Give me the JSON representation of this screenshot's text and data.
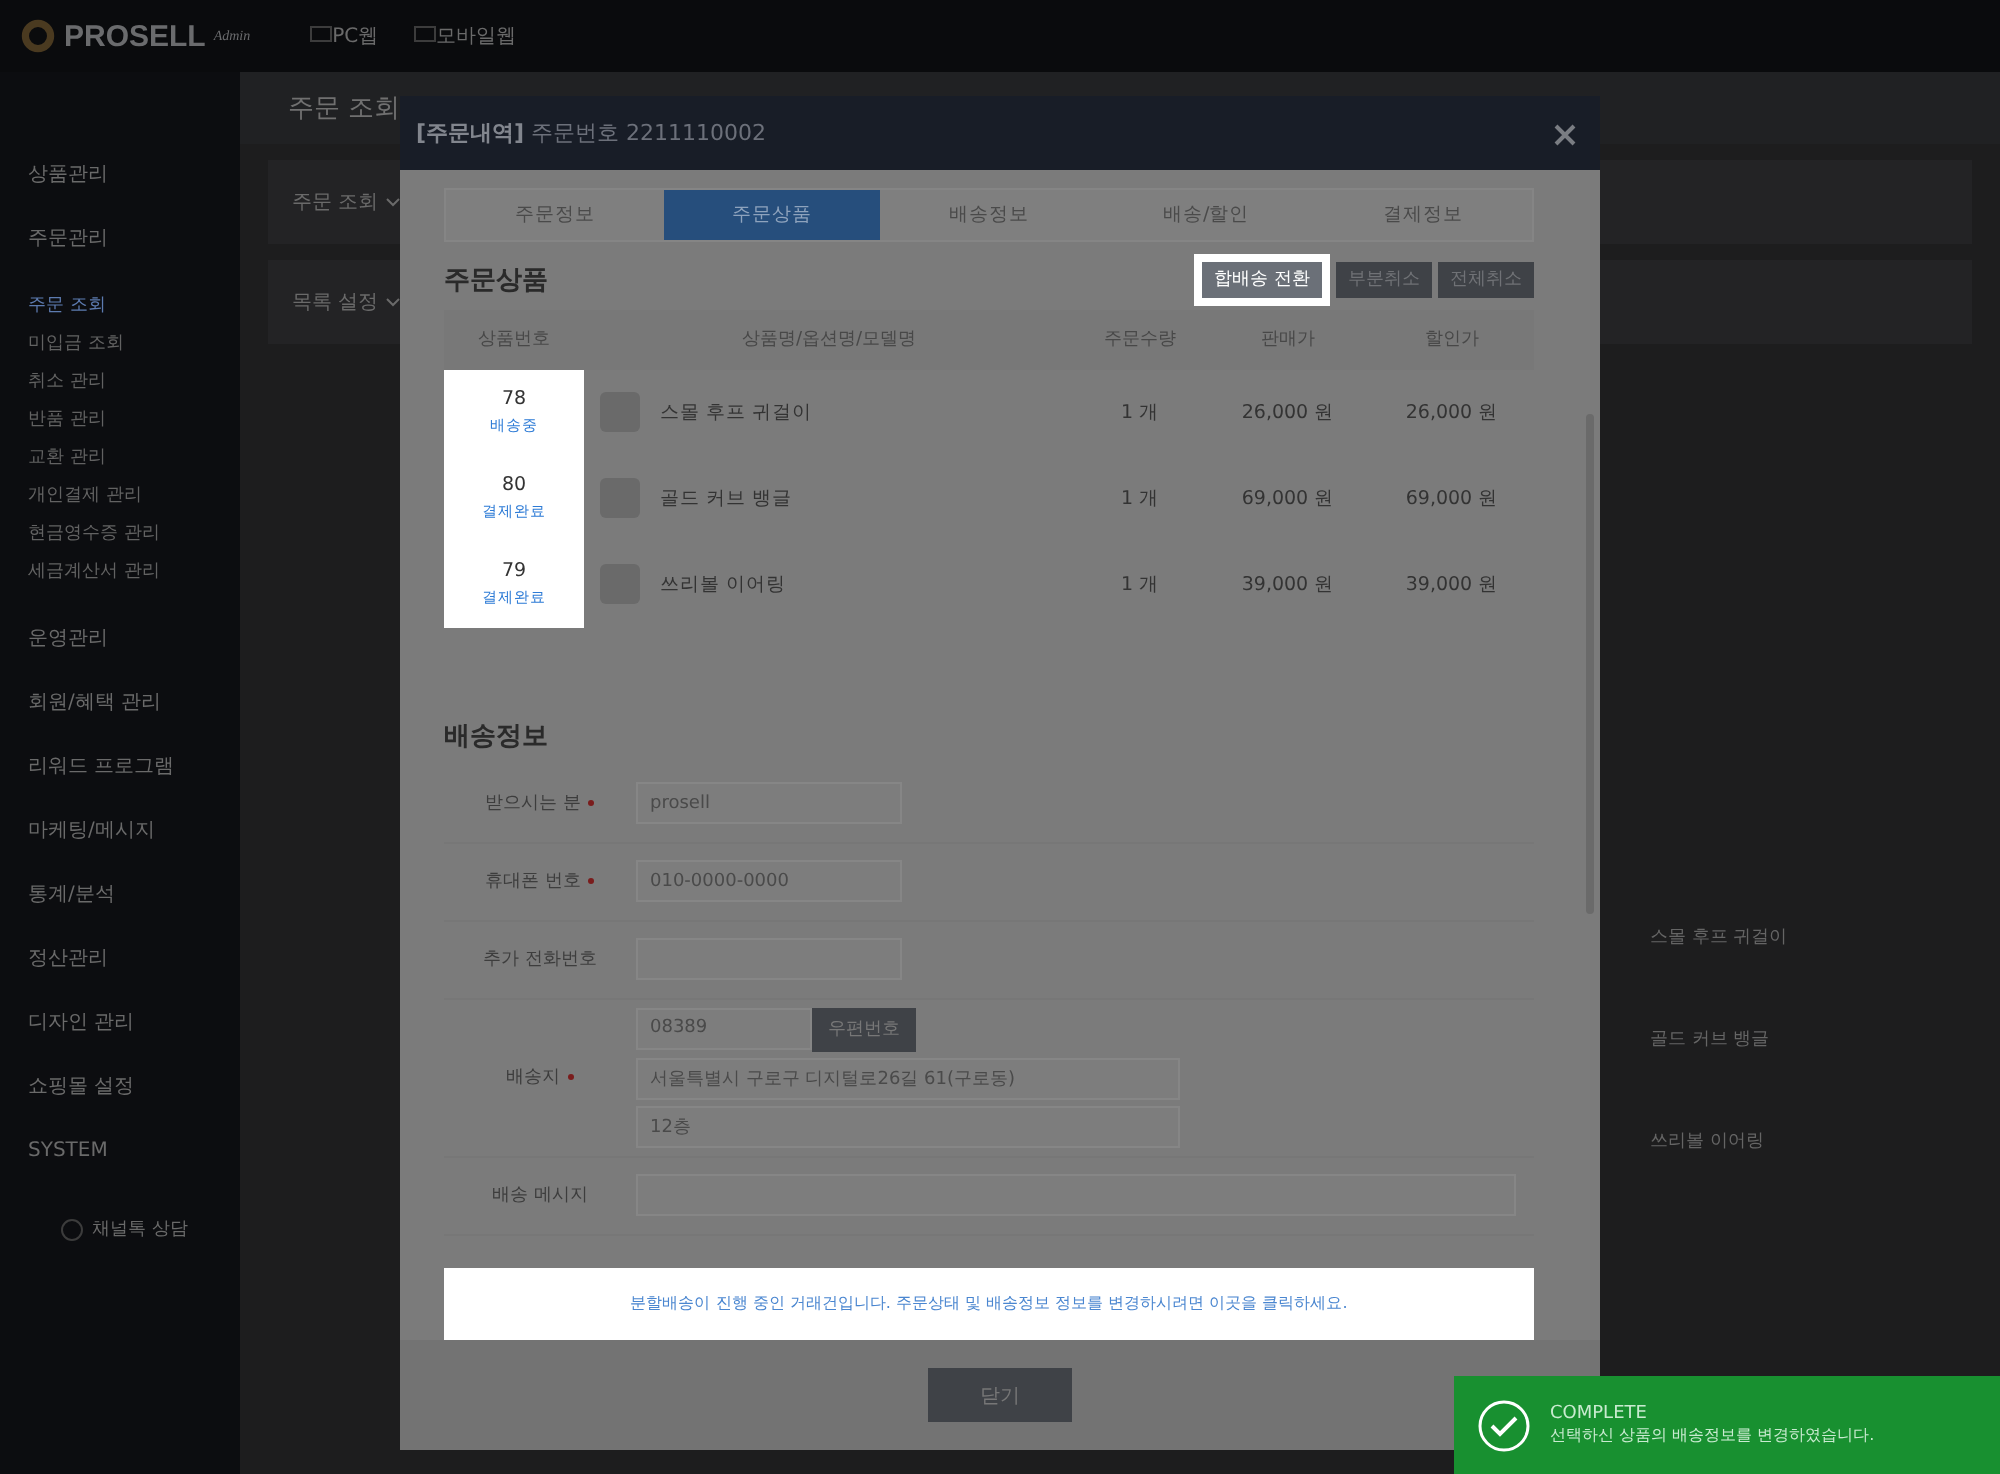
{
  "header": {
    "logo": "PROSELL",
    "logo_sub": "Admin",
    "links": [
      "PC웹",
      "모바일웹"
    ]
  },
  "sidebar": {
    "items": [
      {
        "label": "상품관리"
      },
      {
        "label": "주문관리",
        "children": [
          {
            "label": "주문 조회",
            "selected": true
          },
          {
            "label": "미입금 조회",
            "selected": false
          },
          {
            "label": "취소 관리",
            "selected": false
          },
          {
            "label": "반품 관리",
            "selected": false
          },
          {
            "label": "교환 관리",
            "selected": false
          },
          {
            "label": "개인결제 관리",
            "selected": false
          },
          {
            "label": "현금영수증 관리",
            "selected": false
          },
          {
            "label": "세금계산서 관리",
            "selected": false
          }
        ]
      },
      {
        "label": "운영관리"
      },
      {
        "label": "회원/혜택 관리"
      },
      {
        "label": "리워드 프로그램"
      },
      {
        "label": "마케팅/메시지"
      },
      {
        "label": "통계/분석"
      },
      {
        "label": "정산관리"
      },
      {
        "label": "디자인 관리"
      },
      {
        "label": "쇼핑몰 설정"
      },
      {
        "label": "SYSTEM"
      }
    ],
    "chat_button": "채널톡 상담"
  },
  "page": {
    "title": "주문 조회",
    "filters": [
      "주문 조회",
      "목록 설정"
    ],
    "product_list": [
      "스몰 후프 귀걸이",
      "골드 커브 뱅글",
      "쓰리볼 이어링"
    ]
  },
  "modal": {
    "title_bold": "[주문내역]",
    "title": "주문번호 2211110002",
    "tabs": [
      {
        "label": "주문정보",
        "selected": false
      },
      {
        "label": "주문상품",
        "selected": true
      },
      {
        "label": "배송정보",
        "selected": false
      },
      {
        "label": "배송/할인",
        "selected": false
      },
      {
        "label": "결제정보",
        "selected": false
      }
    ],
    "products": {
      "title": "주문상품",
      "buttons": [
        {
          "label": "합배송 전환",
          "highlighted": true
        },
        {
          "label": "부분취소",
          "highlighted": false
        },
        {
          "label": "전체취소",
          "highlighted": false
        }
      ],
      "columns": [
        "상품번호",
        "상품명/옵션명/모델명",
        "주문수량",
        "판매가",
        "할인가"
      ],
      "rows": [
        {
          "number": "78",
          "status": "배송중",
          "highlighted": true,
          "name": "스몰 후프 귀걸이",
          "qty": "1 개",
          "price": "26,000 원",
          "discount_price": "26,000 원"
        },
        {
          "number": "80",
          "status": "결제완료",
          "highlighted": true,
          "name": "골드 커브 뱅글",
          "qty": "1 개",
          "price": "69,000 원",
          "discount_price": "69,000 원"
        },
        {
          "number": "79",
          "status": "결제완료",
          "highlighted": true,
          "name": "쓰리볼 이어링",
          "qty": "1 개",
          "price": "39,000 원",
          "discount_price": "39,000 원"
        }
      ]
    },
    "shipping": {
      "title": "배송정보",
      "fields": [
        {
          "kind": "text",
          "label": "받으시는 분",
          "required": true,
          "value": "prosell"
        },
        {
          "kind": "text",
          "label": "휴대폰 번호",
          "required": true,
          "value": "010-0000-0000"
        },
        {
          "kind": "text",
          "label": "추가 전화번호",
          "required": false
        },
        {
          "kind": "address",
          "label": "배송지",
          "required": true,
          "zip": "08389",
          "zip_button": "우편번호",
          "address": "서울특별시 구로구 디지털로26길 61(구로동)",
          "detail": "12층"
        },
        {
          "kind": "wide",
          "label": "배송 메시지",
          "required": false
        }
      ]
    },
    "notice": {
      "text": "분할배송이 진행 중인 거래건입니다. 주문상태 및 배송정보 정보를 변경하시려면 이곳을 클릭하세요.",
      "highlighted": true
    },
    "close_button": "닫기"
  },
  "toast": {
    "title": "COMPLETE",
    "message": "선택하신 상품의 배송정보를 변경하였습니다."
  }
}
